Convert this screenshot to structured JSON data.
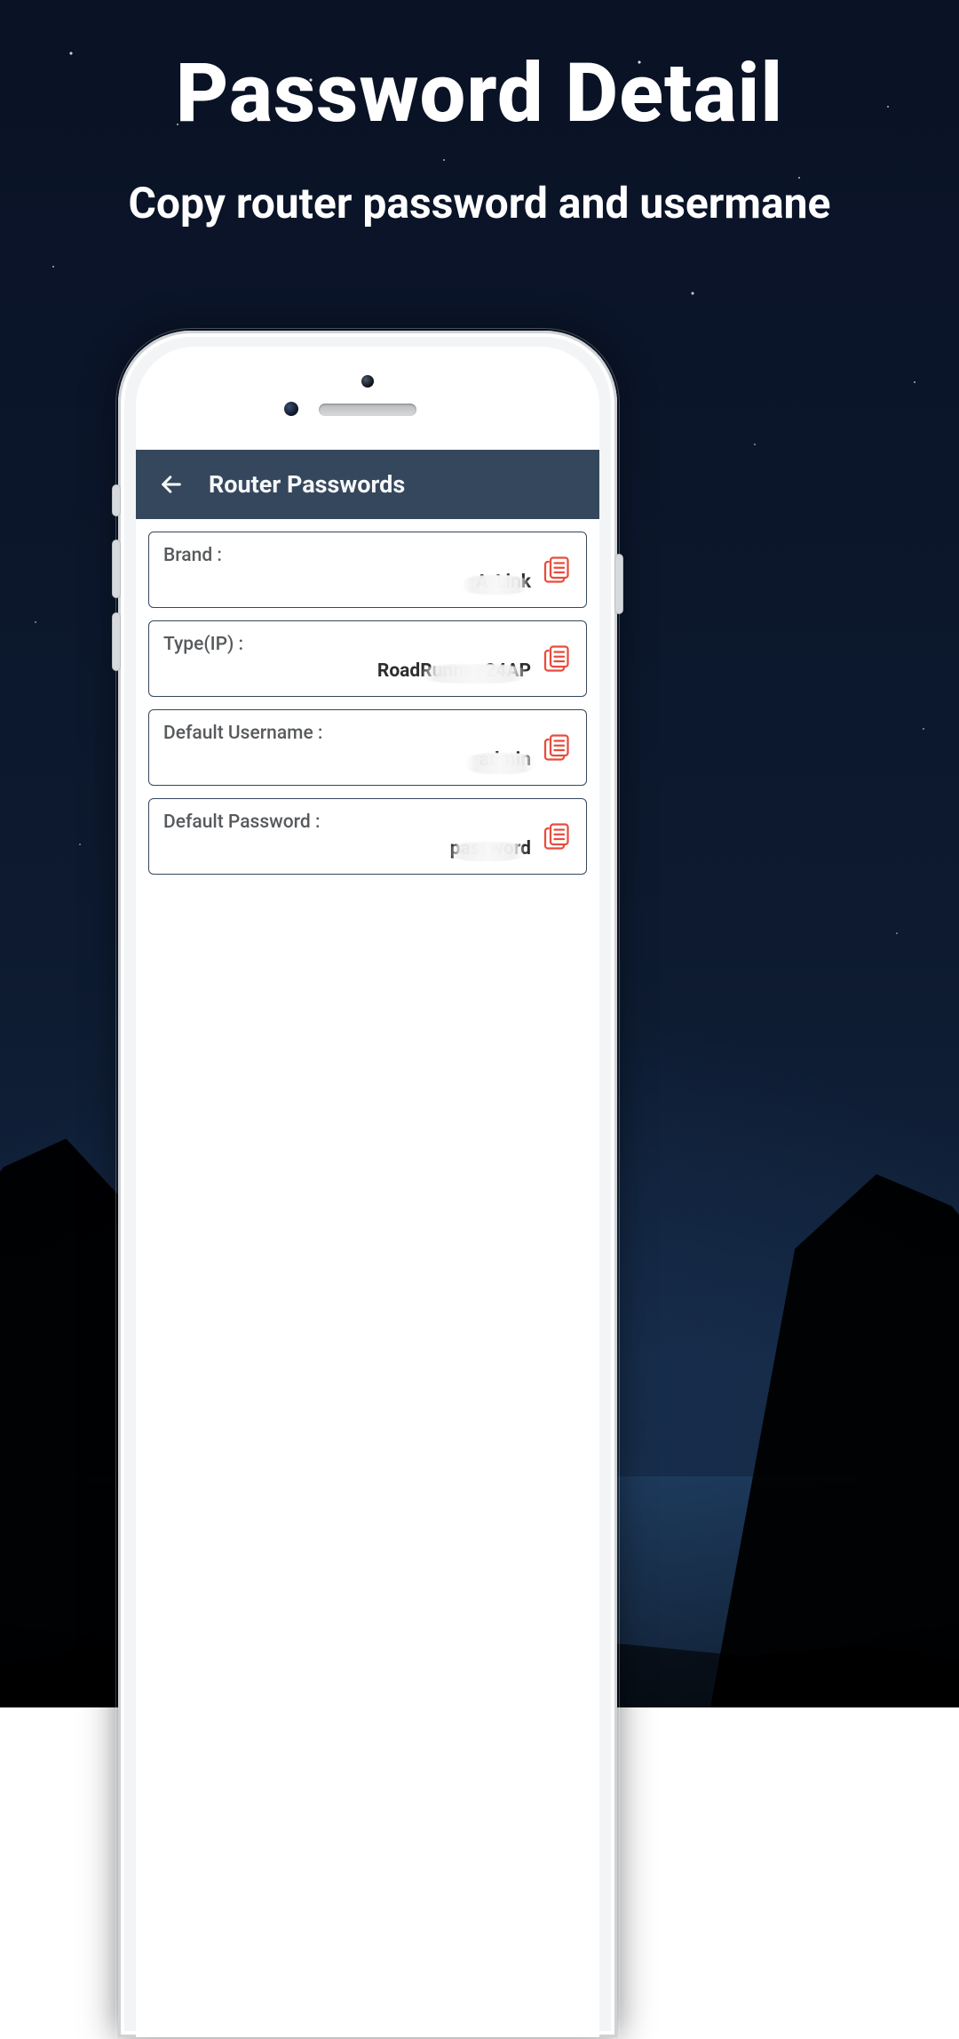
{
  "promo": {
    "title": "Password Detail",
    "subtitle": "Copy router password and usermane"
  },
  "appbar": {
    "title": "Router Passwords"
  },
  "fields": {
    "brand": {
      "label": "Brand :",
      "value": "A‑Link"
    },
    "type_ip": {
      "label": "Type(IP) :",
      "value": "RoadRunner 24AP"
    },
    "default_username": {
      "label": "Default Username :",
      "value": "admin"
    },
    "default_password": {
      "label": "Default Password :",
      "value": "password"
    }
  },
  "colors": {
    "appbar_bg": "#35475c",
    "card_border": "#35475c",
    "copy_icon": "#e74c3c"
  }
}
